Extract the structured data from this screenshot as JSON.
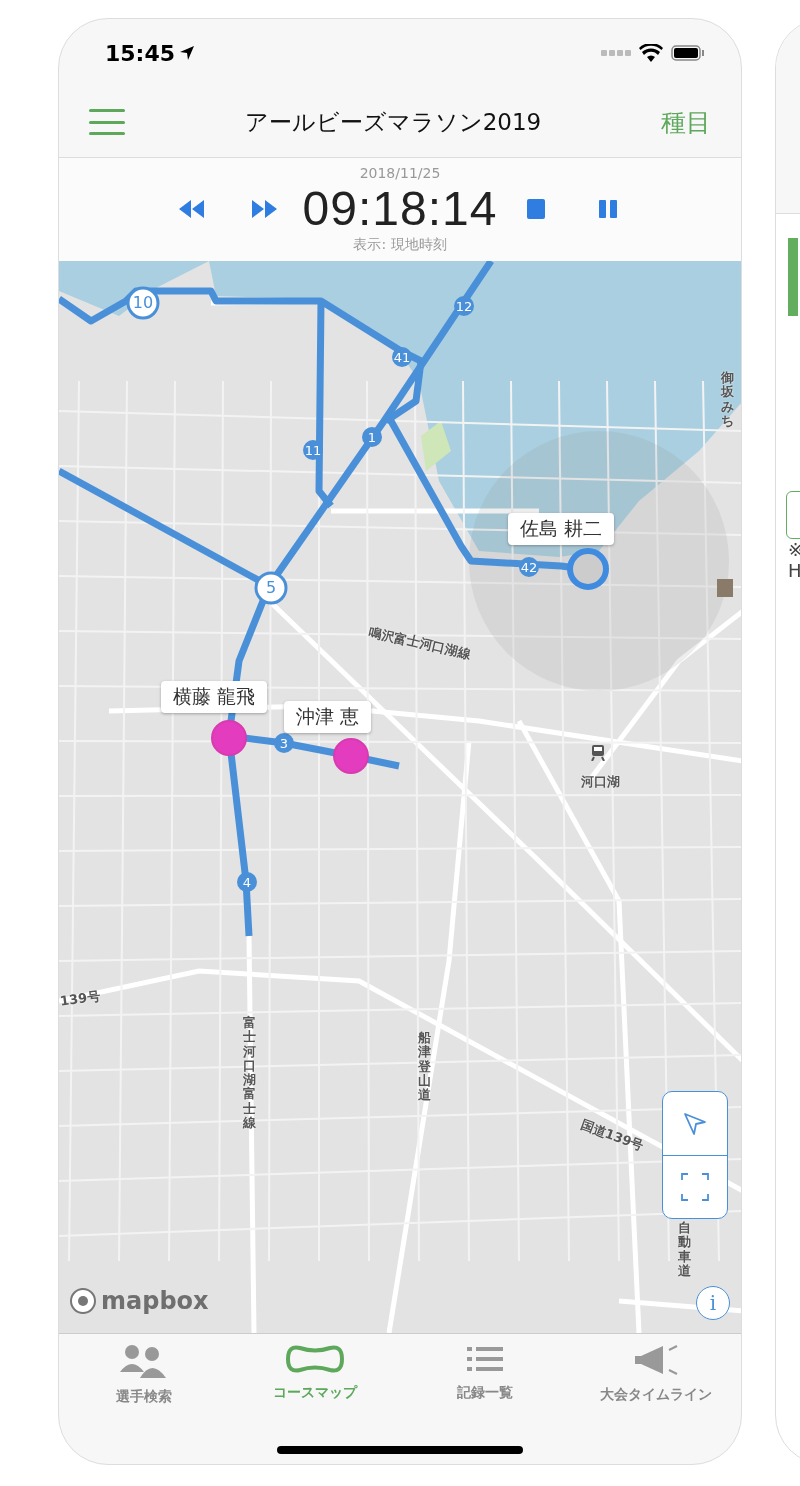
{
  "status_bar": {
    "time": "15:45"
  },
  "nav": {
    "title": "アールビーズマラソン2019",
    "right_button": "種目"
  },
  "playback": {
    "date": "2018/11/25",
    "time": "09:18:14",
    "display_note": "表示: 現地時刻"
  },
  "map": {
    "markers": [
      {
        "label": "10",
        "kind": "hollow"
      },
      {
        "label": "12",
        "kind": "filled"
      },
      {
        "label": "41",
        "kind": "filled"
      },
      {
        "label": "11",
        "kind": "filled"
      },
      {
        "label": "1",
        "kind": "filled"
      },
      {
        "label": "5",
        "kind": "hollow"
      },
      {
        "label": "42",
        "kind": "filled"
      },
      {
        "label": "3",
        "kind": "filled"
      },
      {
        "label": "4",
        "kind": "filled"
      }
    ],
    "runners": [
      {
        "name": "佐島 耕二",
        "kind": "finished"
      },
      {
        "name": "横藤 龍飛",
        "kind": "running"
      },
      {
        "name": "沖津 恵",
        "kind": "running"
      }
    ],
    "place_labels": [
      {
        "text": "鳴沢富士河口湖線",
        "kind": "rotated"
      },
      {
        "text": "河口湖",
        "kind": "station"
      },
      {
        "text": "139号",
        "kind": "rotated"
      },
      {
        "text": "富士河口湖富士線",
        "kind": "vertical"
      },
      {
        "text": "船津登山道",
        "kind": "vertical"
      },
      {
        "text": "国道139号",
        "kind": "rotated"
      },
      {
        "text": "自動車道",
        "kind": "vertical"
      },
      {
        "text": "御坂みち",
        "kind": "vertical"
      }
    ],
    "attribution": "mapbox",
    "info": "i"
  },
  "tabs": [
    {
      "label": "選手検索",
      "kind": "people",
      "selected": false
    },
    {
      "label": "コースマップ",
      "kind": "course",
      "selected": true
    },
    {
      "label": "記録一覧",
      "kind": "list",
      "selected": false
    },
    {
      "label": "大会タイムライン",
      "kind": "megaphone",
      "selected": false
    }
  ],
  "right_phone": {
    "texts": [
      "※",
      "H"
    ]
  }
}
